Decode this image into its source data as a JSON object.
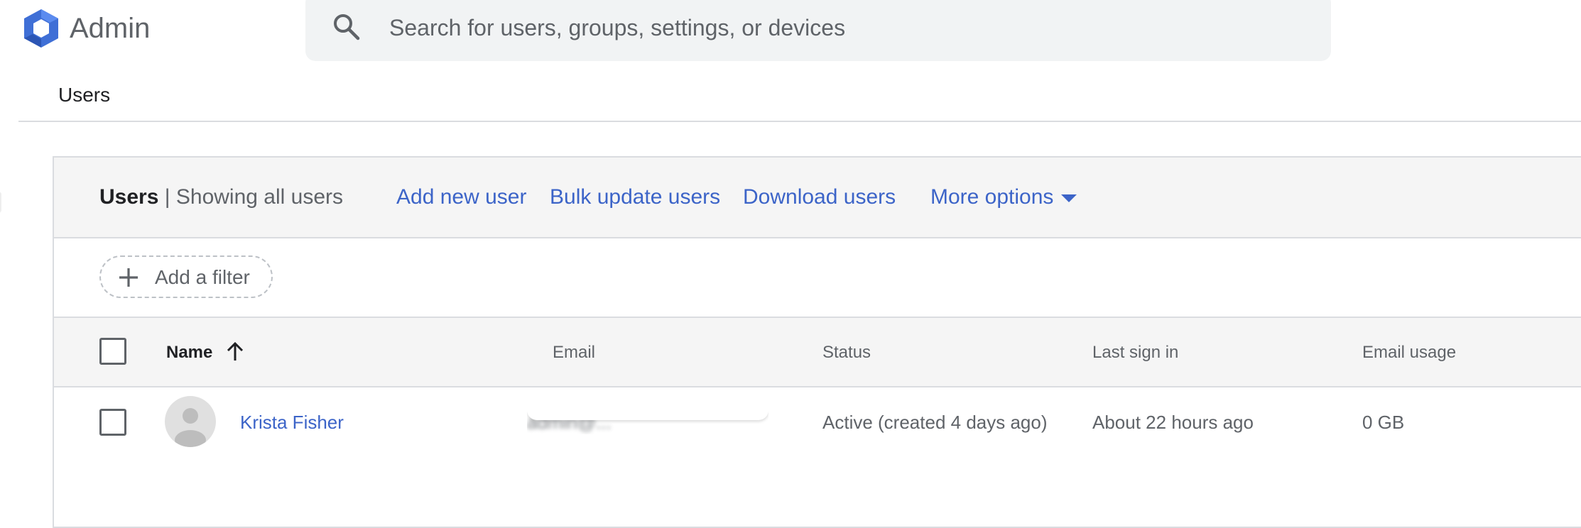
{
  "app": {
    "brand": "Admin"
  },
  "search": {
    "placeholder": "Search for users, groups, settings, or devices",
    "value": ""
  },
  "breadcrumb": {
    "label": "Users"
  },
  "card": {
    "title": "Users",
    "separator": "|",
    "subtitle": "Showing all users",
    "actions": [
      {
        "label": "Add new user"
      },
      {
        "label": "Bulk update users"
      },
      {
        "label": "Download users"
      },
      {
        "label": "More options"
      }
    ],
    "filter_label": "Add a filter"
  },
  "table": {
    "columns": {
      "name": "Name",
      "email": "Email",
      "status": "Status",
      "last_sign_in": "Last sign in",
      "email_usage": "Email usage"
    },
    "sort": {
      "column": "name",
      "direction": "ascending"
    },
    "rows": [
      {
        "name": "Krista Fisher",
        "email": "admin@...",
        "status": "Active (created 4 days ago)",
        "last_sign_in": "About 22 hours ago",
        "email_usage": "0 GB"
      }
    ]
  },
  "colors": {
    "accent": "#3c64c8",
    "logo_blue": "#4a77d4",
    "header_bg": "#f5f5f5",
    "divider": "#dadce0"
  },
  "icons": {
    "logo": "admin-logo-hexagon",
    "search": "search-icon",
    "add_filter": "plus-icon",
    "sort": "arrow-up-icon",
    "more_options": "caret-down-icon",
    "avatar": "default-person-avatar"
  }
}
